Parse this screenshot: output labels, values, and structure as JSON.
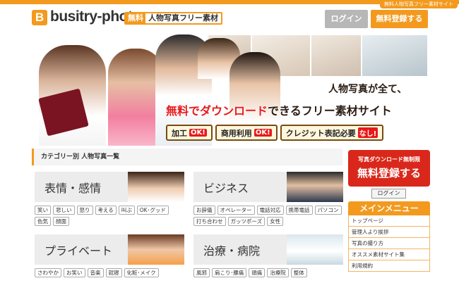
{
  "topbar": {
    "tab_text": "無料人物写真フリー素材サイト"
  },
  "header": {
    "logo_letter": "B",
    "logo_text": "busitry-photo",
    "tagline_free": "無料",
    "tagline_rest": "人物写真フリー素材",
    "login_label": "ログイン",
    "register_label": "無料登録する"
  },
  "hero": {
    "title": "人物写真が全て、",
    "sub_highlight": "無料でダウンロード",
    "sub_rest": "できるフリー素材サイト",
    "badges": [
      {
        "label": "加工",
        "mark": "OK!"
      },
      {
        "label": "商用利用",
        "mark": "OK!"
      },
      {
        "label": "クレジット表記必要",
        "mark": "なし!"
      }
    ]
  },
  "breadcrumb": {
    "text": "カテゴリー別 人物写真一覧"
  },
  "categories": [
    {
      "title": "表情・感情",
      "tags": [
        "笑い",
        "悲しい",
        "怒り",
        "考える",
        "叫ぶ",
        "OK･グッド",
        "色気",
        "顔面"
      ]
    },
    {
      "title": "ビジネス",
      "tags": [
        "お辞儀",
        "オペレーター",
        "電話対応",
        "携帯電話",
        "パソコン",
        "打ち合わせ",
        "ガッツポーズ",
        "女性"
      ]
    },
    {
      "title": "プライベート",
      "tags": [
        "さわやか",
        "お笑い",
        "音楽",
        "就寝",
        "化粧･メイク"
      ]
    },
    {
      "title": "治療・病院",
      "tags": [
        "風邪",
        "肩こり･腰痛",
        "頭痛",
        "治療院",
        "整体"
      ]
    }
  ],
  "sidebar": {
    "cta_small": "写真ダウンロード無制限",
    "cta_big": "無料登録する",
    "login_label": "ログイン",
    "menu_title": "メインメニュー",
    "menu_items": [
      "トップページ",
      "管理人より挨拶",
      "写真の撮り方",
      "オススメ素材サイト集",
      "利用規約"
    ]
  }
}
